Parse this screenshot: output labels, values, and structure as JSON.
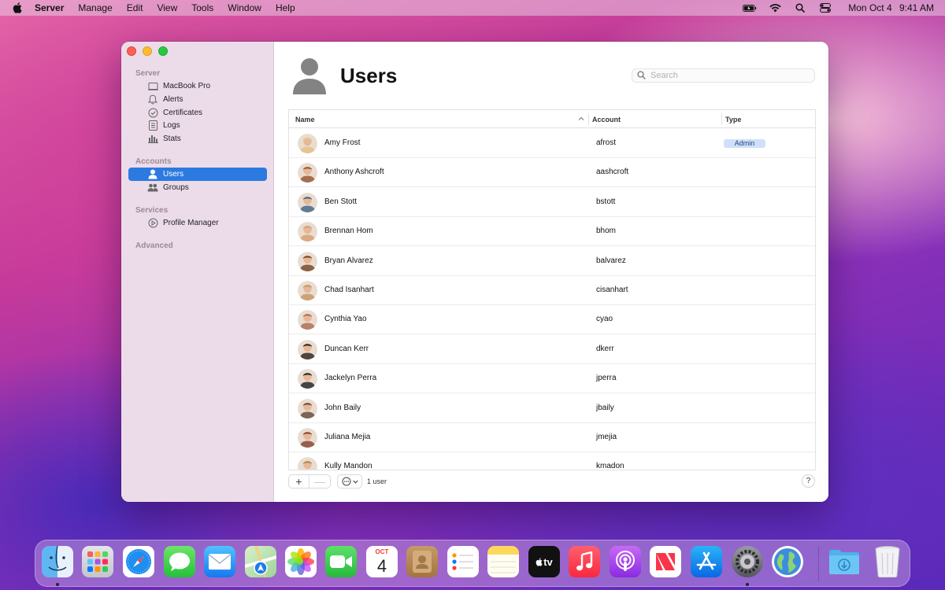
{
  "menubar": {
    "app_name": "Server",
    "items": [
      "Manage",
      "Edit",
      "View",
      "Tools",
      "Window",
      "Help"
    ],
    "date": "Mon Oct 4",
    "time": "9:41 AM"
  },
  "sidebar": {
    "sections": [
      {
        "title": "Server",
        "items": [
          {
            "label": "MacBook Pro",
            "icon": "laptop-icon"
          },
          {
            "label": "Alerts",
            "icon": "bell-icon"
          },
          {
            "label": "Certificates",
            "icon": "certificate-icon"
          },
          {
            "label": "Logs",
            "icon": "log-icon"
          },
          {
            "label": "Stats",
            "icon": "stats-icon"
          }
        ]
      },
      {
        "title": "Accounts",
        "items": [
          {
            "label": "Users",
            "icon": "user-icon",
            "selected": true
          },
          {
            "label": "Groups",
            "icon": "groups-icon"
          }
        ]
      },
      {
        "title": "Services",
        "items": [
          {
            "label": "Profile Manager",
            "icon": "profile-manager-icon"
          }
        ]
      },
      {
        "title": "Advanced",
        "items": []
      }
    ]
  },
  "main": {
    "title": "Users",
    "search_placeholder": "Search",
    "columns": {
      "name": "Name",
      "account": "Account",
      "type": "Type"
    },
    "rows": [
      {
        "name": "Amy Frost",
        "account": "afrost",
        "type": "Admin",
        "color": "#e8c08a"
      },
      {
        "name": "Anthony Ashcroft",
        "account": "aashcroft",
        "type": "",
        "color": "#9a5a3a"
      },
      {
        "name": "Ben Stott",
        "account": "bstott",
        "type": "",
        "color": "#4a6a8a"
      },
      {
        "name": "Brennan Hom",
        "account": "bhom",
        "type": "",
        "color": "#d8a078"
      },
      {
        "name": "Bryan Alvarez",
        "account": "balvarez",
        "type": "",
        "color": "#7a4a2a"
      },
      {
        "name": "Chad Isanhart",
        "account": "cisanhart",
        "type": "",
        "color": "#c49a6a"
      },
      {
        "name": "Cynthia Yao",
        "account": "cyao",
        "type": "",
        "color": "#b07058"
      },
      {
        "name": "Duncan Kerr",
        "account": "dkerr",
        "type": "",
        "color": "#3a2a22"
      },
      {
        "name": "Jackelyn Perra",
        "account": "jperra",
        "type": "",
        "color": "#2a2a2a"
      },
      {
        "name": "John Baily",
        "account": "jbaily",
        "type": "",
        "color": "#6a5040"
      },
      {
        "name": "Juliana Mejia",
        "account": "jmejia",
        "type": "",
        "color": "#8a4a3a"
      },
      {
        "name": "Kully Mandon",
        "account": "kmadon",
        "type": "",
        "color": "#b08a50"
      }
    ],
    "footer": {
      "add": "+",
      "remove": "—",
      "count": "1 user",
      "help": "?"
    }
  },
  "dock": {
    "calendar_month": "OCT",
    "calendar_day": "4",
    "tv_label": "tv",
    "apps": [
      "Finder",
      "Launchpad",
      "Safari",
      "Messages",
      "Mail",
      "Maps",
      "Photos",
      "FaceTime",
      "Calendar",
      "Contacts",
      "Reminders",
      "Notes",
      "TV",
      "Music",
      "Podcasts",
      "News",
      "App Store",
      "System Preferences",
      "Network Utility",
      "Downloads",
      "Trash"
    ]
  }
}
